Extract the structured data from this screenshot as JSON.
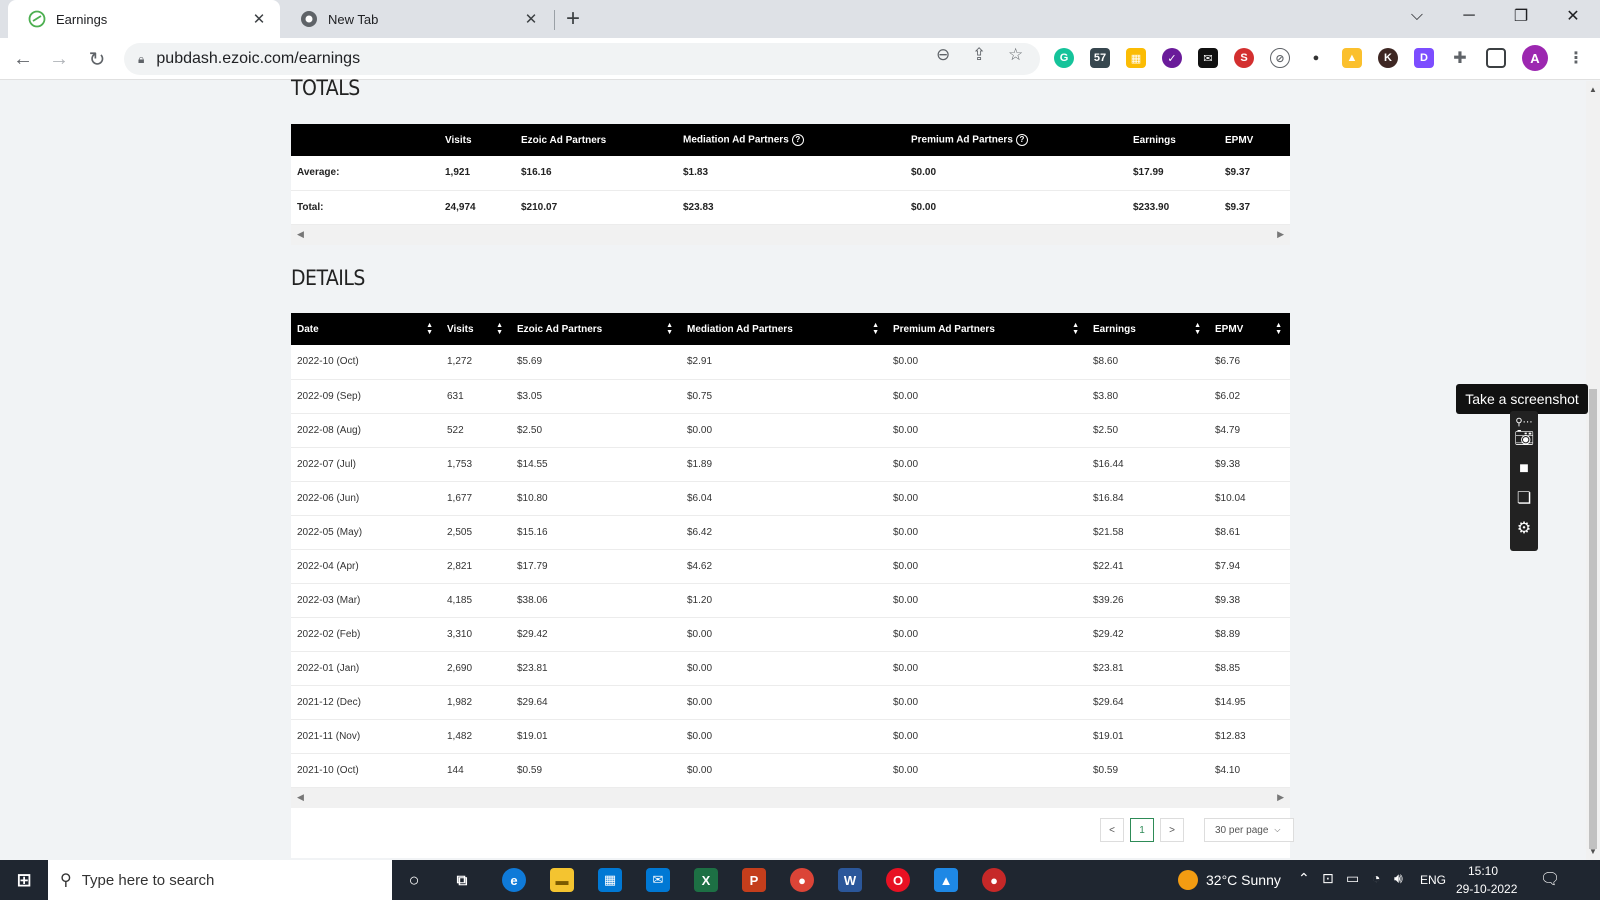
{
  "browser": {
    "tabs": [
      {
        "title": "Earnings",
        "active": true
      },
      {
        "title": "New Tab",
        "active": false
      }
    ],
    "url": "pubdash.ezoic.com/earnings"
  },
  "totals": {
    "title": "TOTALS",
    "headers": [
      "",
      "Visits",
      "Ezoic Ad Partners",
      "Mediation Ad Partners",
      "Premium Ad Partners",
      "Earnings",
      "EPMV"
    ],
    "rows": [
      [
        "Average:",
        "1,921",
        "$16.16",
        "$1.83",
        "$0.00",
        "$17.99",
        "$9.37"
      ],
      [
        "Total:",
        "24,974",
        "$210.07",
        "$23.83",
        "$0.00",
        "$233.90",
        "$9.37"
      ]
    ]
  },
  "details": {
    "title": "DETAILS",
    "headers": [
      "Date",
      "Visits",
      "Ezoic Ad Partners",
      "Mediation Ad Partners",
      "Premium Ad Partners",
      "Earnings",
      "EPMV"
    ],
    "rows": [
      [
        "2022-10 (Oct)",
        "1,272",
        "$5.69",
        "$2.91",
        "$0.00",
        "$8.60",
        "$6.76"
      ],
      [
        "2022-09 (Sep)",
        "631",
        "$3.05",
        "$0.75",
        "$0.00",
        "$3.80",
        "$6.02"
      ],
      [
        "2022-08 (Aug)",
        "522",
        "$2.50",
        "$0.00",
        "$0.00",
        "$2.50",
        "$4.79"
      ],
      [
        "2022-07 (Jul)",
        "1,753",
        "$14.55",
        "$1.89",
        "$0.00",
        "$16.44",
        "$9.38"
      ],
      [
        "2022-06 (Jun)",
        "1,677",
        "$10.80",
        "$6.04",
        "$0.00",
        "$16.84",
        "$10.04"
      ],
      [
        "2022-05 (May)",
        "2,505",
        "$15.16",
        "$6.42",
        "$0.00",
        "$21.58",
        "$8.61"
      ],
      [
        "2022-04 (Apr)",
        "2,821",
        "$17.79",
        "$4.62",
        "$0.00",
        "$22.41",
        "$7.94"
      ],
      [
        "2022-03 (Mar)",
        "4,185",
        "$38.06",
        "$1.20",
        "$0.00",
        "$39.26",
        "$9.38"
      ],
      [
        "2022-02 (Feb)",
        "3,310",
        "$29.42",
        "$0.00",
        "$0.00",
        "$29.42",
        "$8.89"
      ],
      [
        "2022-01 (Jan)",
        "2,690",
        "$23.81",
        "$0.00",
        "$0.00",
        "$23.81",
        "$8.85"
      ],
      [
        "2021-12 (Dec)",
        "1,982",
        "$29.64",
        "$0.00",
        "$0.00",
        "$29.64",
        "$14.95"
      ],
      [
        "2021-11 (Nov)",
        "1,482",
        "$19.01",
        "$0.00",
        "$0.00",
        "$19.01",
        "$12.83"
      ],
      [
        "2021-10 (Oct)",
        "144",
        "$0.59",
        "$0.00",
        "$0.00",
        "$0.59",
        "$4.10"
      ]
    ]
  },
  "pagination": {
    "prev": "<",
    "current": "1",
    "next": ">",
    "per_page": "30 per page"
  },
  "screenshot_widget": {
    "tooltip": "Take a screenshot"
  },
  "taskbar": {
    "search_placeholder": "Type here to search",
    "weather": "32°C  Sunny",
    "language": "ENG",
    "time": "15:10",
    "date": "29-10-2022"
  }
}
